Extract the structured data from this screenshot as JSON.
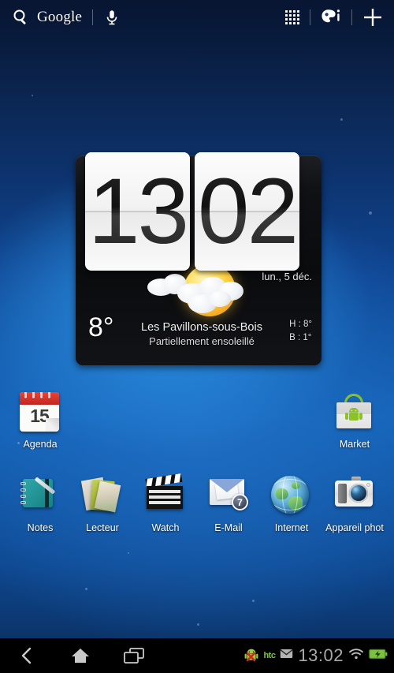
{
  "statusbar": {
    "search_icon": "search-icon",
    "brand": "Google",
    "mic_icon": "microphone-icon",
    "apps_grid_icon": "apps-grid-icon",
    "personalize_icon": "personalize-icon",
    "add_icon": "plus-icon"
  },
  "widget": {
    "clock": {
      "hours": "13",
      "minutes": "02"
    },
    "weather": {
      "date": "lun., 5 déc.",
      "temperature": "8°",
      "city": "Les Pavillons-sous-Bois",
      "condition": "Partiellement ensoleillé",
      "high": "H : 8°",
      "low": "B : 1°",
      "icon": "sun-behind-cloud-icon"
    }
  },
  "apps_row_top": [
    {
      "label": "Agenda",
      "icon": "calendar-icon",
      "calendar_day": "15"
    },
    {
      "label": "Market",
      "icon": "shopping-bag-icon"
    }
  ],
  "apps_row_bottom": [
    {
      "label": "Notes",
      "icon": "notebook-icon"
    },
    {
      "label": "Lecteur",
      "icon": "magazines-icon"
    },
    {
      "label": "Watch",
      "icon": "clapperboard-icon"
    },
    {
      "label": "E-Mail",
      "icon": "envelope-icon",
      "badge": "7"
    },
    {
      "label": "Internet",
      "icon": "globe-icon"
    },
    {
      "label": "Appareil phot",
      "icon": "camera-icon"
    }
  ],
  "navbar": {
    "back_icon": "back-chevron-icon",
    "home_icon": "home-icon",
    "recents_icon": "recent-apps-icon",
    "android_icon": "android-robot-icon",
    "carrier": "htc",
    "mail_icon": "envelope-status-icon",
    "time": "13:02",
    "wifi_icon": "wifi-icon",
    "battery_icon": "battery-charging-icon"
  },
  "colors": {
    "background_deep": "#06142f",
    "background_bright": "#2a8fe0",
    "accent_green": "#7cc242",
    "widget_dark": "#0a0b0d",
    "label_text": "#ffffff"
  }
}
